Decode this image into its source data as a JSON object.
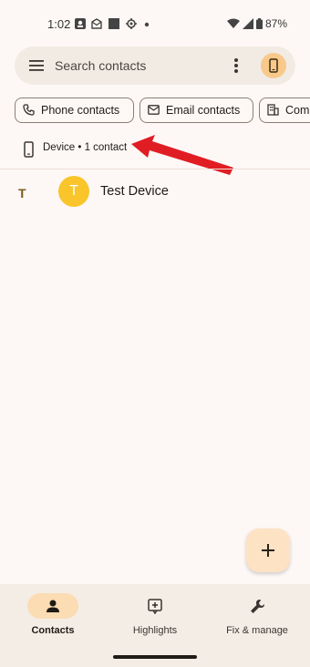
{
  "status_bar": {
    "time": "1:02",
    "battery_percent": "87%",
    "icons": [
      "photo-notification-icon",
      "mail-notification-icon",
      "app-notification-icon",
      "settings-notification-icon",
      "dot-icon",
      "wifi-icon",
      "signal-icon",
      "battery-icon"
    ]
  },
  "search": {
    "placeholder": "Search contacts"
  },
  "chips": [
    {
      "label": "Phone contacts",
      "icon": "phone-icon"
    },
    {
      "label": "Email contacts",
      "icon": "email-icon"
    },
    {
      "label": "Com",
      "icon": "company-icon"
    }
  ],
  "device_row": {
    "label": "Device • 1 contact",
    "icon": "device-icon"
  },
  "contacts": [
    {
      "section_letter": "T",
      "avatar_letter": "T",
      "name": "Test Device",
      "avatar_color": "#f9c52a"
    }
  ],
  "annotation": {
    "arrow_color": "#e11d24"
  },
  "nav": {
    "items": [
      {
        "label": "Contacts",
        "icon": "person-icon",
        "active": true
      },
      {
        "label": "Highlights",
        "icon": "highlights-icon",
        "active": false
      },
      {
        "label": "Fix & manage",
        "icon": "wrench-icon",
        "active": false
      }
    ]
  },
  "colors": {
    "accent": "#fbdcb3",
    "background": "#fdf8f6",
    "fab": "#fde2c4"
  }
}
